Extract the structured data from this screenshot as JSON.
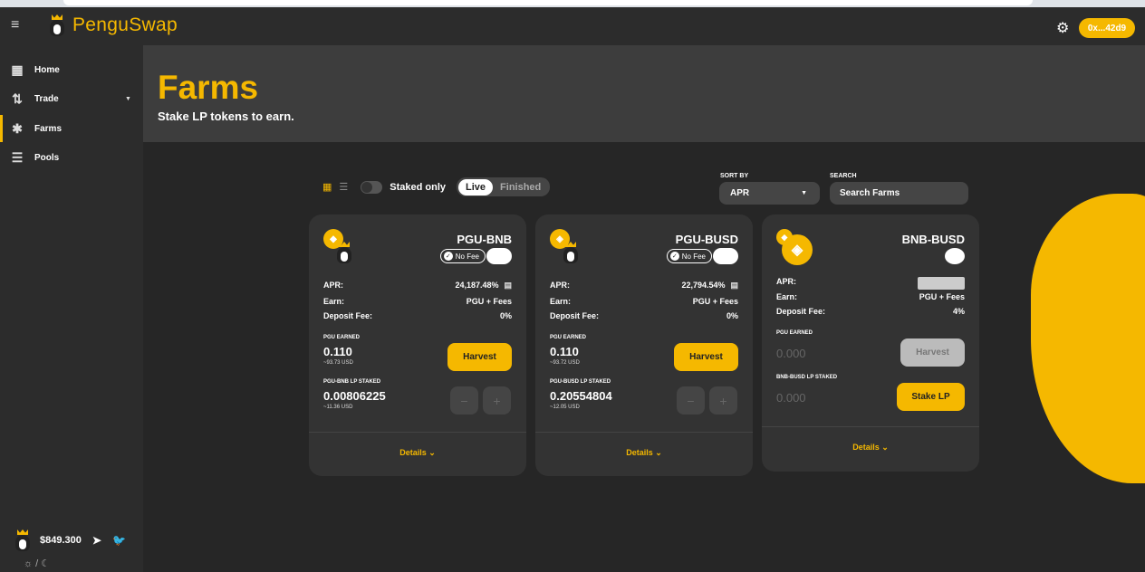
{
  "app": {
    "name": "PenguSwap"
  },
  "header": {
    "wallet_label": "0x...42d9",
    "menu_icon": "collapse-menu-icon",
    "settings_icon": "gear-icon"
  },
  "sidebar": {
    "items": [
      {
        "label": "Home",
        "icon": "grid-icon"
      },
      {
        "label": "Trade",
        "icon": "swap-arrows-icon"
      },
      {
        "label": "Farms",
        "icon": "farm-plant-icon"
      },
      {
        "label": "Pools",
        "icon": "coin-stack-icon"
      }
    ],
    "price": "$849.300",
    "theme": "☼ / ☾"
  },
  "hero": {
    "title": "Farms",
    "subtitle": "Stake LP tokens to earn."
  },
  "controls": {
    "staked_only": "Staked only",
    "live": "Live",
    "finished": "Finished",
    "sort_by_label": "SORT BY",
    "sort_by_value": "APR",
    "search_label": "SEARCH",
    "search_placeholder": "Search Farms"
  },
  "farms": [
    {
      "title": "PGU-BNB",
      "badge": "No Fee",
      "apr_label": "APR:",
      "apr": "24,187.48%",
      "earn_label": "Earn:",
      "earn": "PGU + Fees",
      "fee_label": "Deposit Fee:",
      "fee": "0%",
      "earned_label": "PGU EARNED",
      "earned": "0.110",
      "earned_usd": "~93.73 USD",
      "harvest": "Harvest",
      "staked_label": "PGU-BNB LP STAKED",
      "staked": "0.00806225",
      "staked_usd": "~11.36 USD",
      "details": "Details ⌄"
    },
    {
      "title": "PGU-BUSD",
      "badge": "No Fee",
      "apr_label": "APR:",
      "apr": "22,794.54%",
      "earn_label": "Earn:",
      "earn": "PGU + Fees",
      "fee_label": "Deposit Fee:",
      "fee": "0%",
      "earned_label": "PGU EARNED",
      "earned": "0.110",
      "earned_usd": "~93.72 USD",
      "harvest": "Harvest",
      "staked_label": "PGU-BUSD LP STAKED",
      "staked": "0.20554804",
      "staked_usd": "~12.05 USD",
      "details": "Details ⌄"
    },
    {
      "title": "BNB-BUSD",
      "apr_label": "APR:",
      "earn_label": "Earn:",
      "earn": "PGU + Fees",
      "fee_label": "Deposit Fee:",
      "fee": "4%",
      "earned_label": "PGU EARNED",
      "earned": "0.000",
      "harvest": "Harvest",
      "staked_label": "BNB-BUSD LP STAKED",
      "staked": "0.000",
      "stake_button": "Stake LP",
      "details": "Details ⌄"
    }
  ]
}
